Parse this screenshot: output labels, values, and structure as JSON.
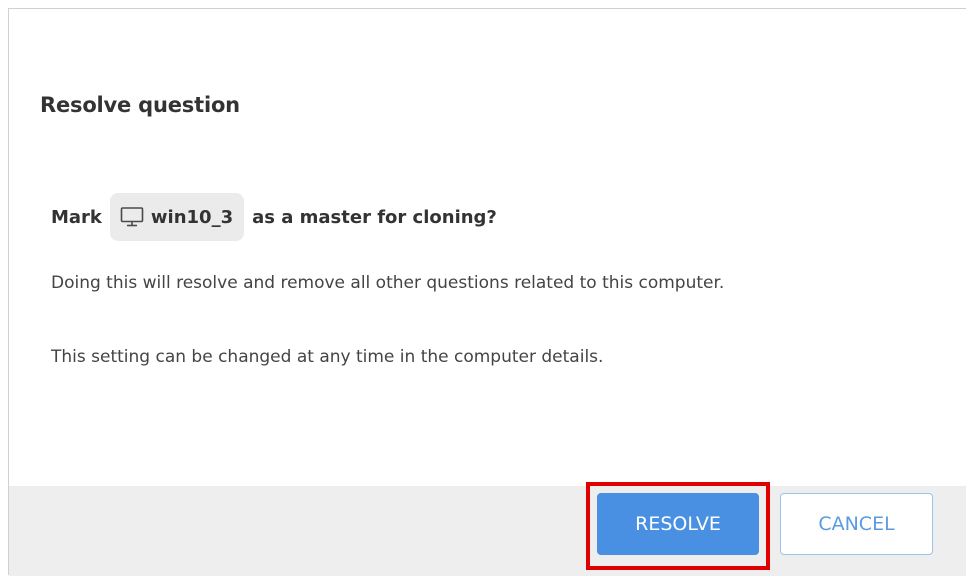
{
  "dialog": {
    "title": "Resolve question",
    "question": {
      "prefix": "Mark",
      "computer_name": "win10_3",
      "computer_icon": "monitor-icon",
      "suffix": "as a master for cloning?"
    },
    "paragraph_1": "Doing this will resolve and remove all other questions related to this computer.",
    "paragraph_2": "This setting can be changed at any time in the computer details.",
    "buttons": {
      "resolve_label": "RESOLVE",
      "cancel_label": "CANCEL"
    }
  },
  "colors": {
    "primary": "#4a90e2",
    "highlight": "#e00000",
    "footer_bg": "#eeeeee"
  }
}
